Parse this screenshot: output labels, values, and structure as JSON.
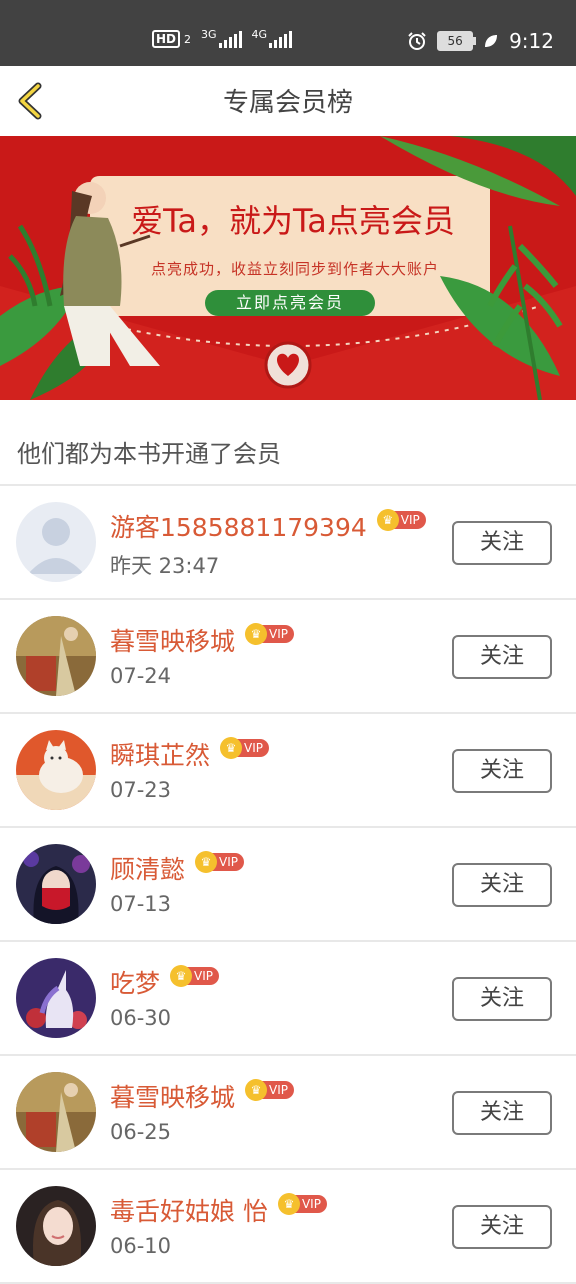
{
  "status_bar": {
    "hd": "HD",
    "sim": "2",
    "net1": "3G",
    "net2": "4G",
    "battery": "56",
    "time": "9:12"
  },
  "header": {
    "back_icon": "chevron-left-icon",
    "title": "专属会员榜"
  },
  "banner": {
    "headline": "爱Ta，就为Ta点亮会员",
    "subline": "点亮成功，收益立刻同步到作者大大账户",
    "cta": "立即点亮会员"
  },
  "section_title": "他们都为本书开通了会员",
  "members": [
    {
      "name": "游客1585881179394",
      "badge": "VIP",
      "date": "昨天 23:47",
      "follow": "关注",
      "avatar": "default-avatar"
    },
    {
      "name": "暮雪映移城",
      "badge": "VIP",
      "date": "07-24",
      "follow": "关注",
      "avatar": "painting-avatar"
    },
    {
      "name": "瞬琪芷然",
      "badge": "VIP",
      "date": "07-23",
      "follow": "关注",
      "avatar": "cat-avatar"
    },
    {
      "name": "顾清懿",
      "badge": "VIP",
      "date": "07-13",
      "follow": "关注",
      "avatar": "masked-girl-avatar"
    },
    {
      "name": "吃梦",
      "badge": "VIP",
      "date": "06-30",
      "follow": "关注",
      "avatar": "unicorn-avatar"
    },
    {
      "name": "暮雪映移城",
      "badge": "VIP",
      "date": "06-25",
      "follow": "关注",
      "avatar": "painting-avatar"
    },
    {
      "name": "毒舌好姑娘 怡",
      "badge": "VIP",
      "date": "06-10",
      "follow": "关注",
      "avatar": "girl-photo-avatar"
    }
  ],
  "colors": {
    "accent_name": "#d85a36",
    "banner_red": "#c91918",
    "vip_tag": "#e0584a",
    "crown": "#f5c02d",
    "cta_green": "#2f8f3a"
  }
}
